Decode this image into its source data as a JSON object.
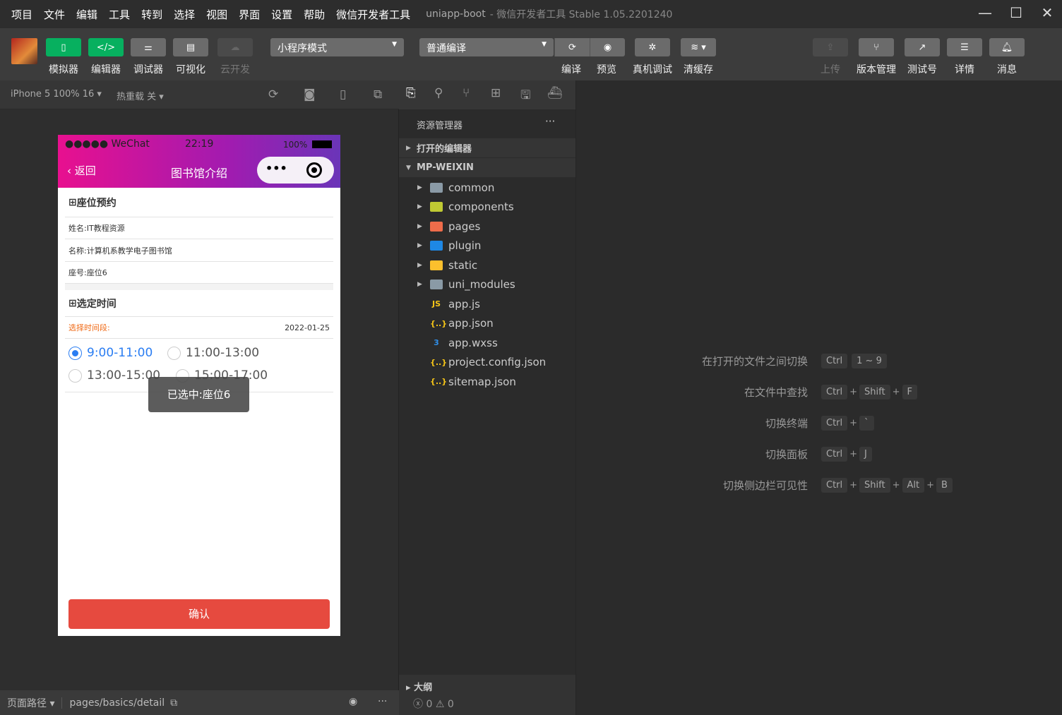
{
  "titlebar": {
    "menus": [
      "项目",
      "文件",
      "编辑",
      "工具",
      "转到",
      "选择",
      "视图",
      "界面",
      "设置",
      "帮助",
      "微信开发者工具"
    ],
    "project": "uniapp-boot",
    "app_title": "- 微信开发者工具 Stable 1.05.2201240"
  },
  "toolbar": {
    "left": [
      {
        "label": "模拟器",
        "icon": "phone-icon"
      },
      {
        "label": "编辑器",
        "icon": "code-icon"
      },
      {
        "label": "调试器",
        "icon": "sliders-icon"
      },
      {
        "label": "可视化",
        "icon": "layout-icon"
      },
      {
        "label": "云开发",
        "icon": "cloud-icon"
      }
    ],
    "mode_select": "小程序模式",
    "compile_select": "普通编译",
    "center": [
      {
        "label": "编译",
        "icon": "refresh-icon"
      },
      {
        "label": "预览",
        "icon": "eye-icon"
      },
      {
        "label": "真机调试",
        "icon": "bug-icon"
      },
      {
        "label": "清缓存",
        "icon": "layers-icon"
      }
    ],
    "right": [
      {
        "label": "上传",
        "icon": "upload-icon"
      },
      {
        "label": "版本管理",
        "icon": "branch-icon"
      },
      {
        "label": "测试号",
        "icon": "external-link-icon"
      },
      {
        "label": "详情",
        "icon": "menu-icon"
      },
      {
        "label": "消息",
        "icon": "bell-icon"
      }
    ]
  },
  "simulator": {
    "device": "iPhone 5 100% 16 ▾",
    "hot_reload": "热重载 关 ▾"
  },
  "phone": {
    "status": {
      "carrier": "●●●●● WeChat",
      "time": "22:19",
      "battery": "100%"
    },
    "nav": {
      "back": "返回",
      "title": "图书馆介绍",
      "more": "•••"
    },
    "section1": "座位预约",
    "info": [
      "姓名:IT教程资源",
      "名称:计算机系教学电子图书馆",
      "座号:座位6"
    ],
    "section2": "选定时间",
    "time_label": "选择时间段:",
    "date": "2022-01-25",
    "options": [
      {
        "label": "9:00-11:00",
        "selected": true
      },
      {
        "label": "11:00-13:00",
        "selected": false
      },
      {
        "label": "13:00-15:00",
        "selected": false
      },
      {
        "label": "15:00-17:00",
        "selected": false
      }
    ],
    "toast": "已选中:座位6",
    "confirm": "确认"
  },
  "explorer": {
    "title": "资源管理器",
    "more": "···",
    "open_editors": "打开的编辑器",
    "root": "MP-WEIXIN",
    "items": [
      {
        "name": "common",
        "folder": true,
        "color": "#8a9aa6"
      },
      {
        "name": "components",
        "folder": true,
        "color": "#c0ca33"
      },
      {
        "name": "pages",
        "folder": true,
        "color": "#ef6c4a"
      },
      {
        "name": "plugin",
        "folder": true,
        "color": "#1e88e5"
      },
      {
        "name": "static",
        "folder": true,
        "color": "#fbc02d"
      },
      {
        "name": "uni_modules",
        "folder": true,
        "color": "#8a9aa6"
      },
      {
        "name": "app.js",
        "folder": false,
        "glyph": "JS",
        "color": "#f5c518"
      },
      {
        "name": "app.json",
        "folder": false,
        "glyph": "{..}",
        "color": "#f5c518"
      },
      {
        "name": "app.wxss",
        "folder": false,
        "glyph": "3",
        "color": "#2f8ee8"
      },
      {
        "name": "project.config.json",
        "folder": false,
        "glyph": "{..}",
        "color": "#f5c518"
      },
      {
        "name": "sitemap.json",
        "folder": false,
        "glyph": "{..}",
        "color": "#f5c518"
      }
    ],
    "outline": "大纲",
    "errors": "0",
    "warnings": "0"
  },
  "shortcuts": [
    {
      "label": "在打开的文件之间切换",
      "keys": [
        "Ctrl",
        "1 ~ 9"
      ],
      "sep": false
    },
    {
      "label": "在文件中查找",
      "keys": [
        "Ctrl",
        "Shift",
        "F"
      ],
      "sep": true
    },
    {
      "label": "切换终端",
      "keys": [
        "Ctrl",
        "`"
      ],
      "sep": true
    },
    {
      "label": "切换面板",
      "keys": [
        "Ctrl",
        "J"
      ],
      "sep": true
    },
    {
      "label": "切换侧边栏可见性",
      "keys": [
        "Ctrl",
        "Shift",
        "Alt",
        "B"
      ],
      "sep": true
    }
  ],
  "bottom": {
    "path_label": "页面路径 ▾",
    "path": "pages/basics/detail"
  }
}
